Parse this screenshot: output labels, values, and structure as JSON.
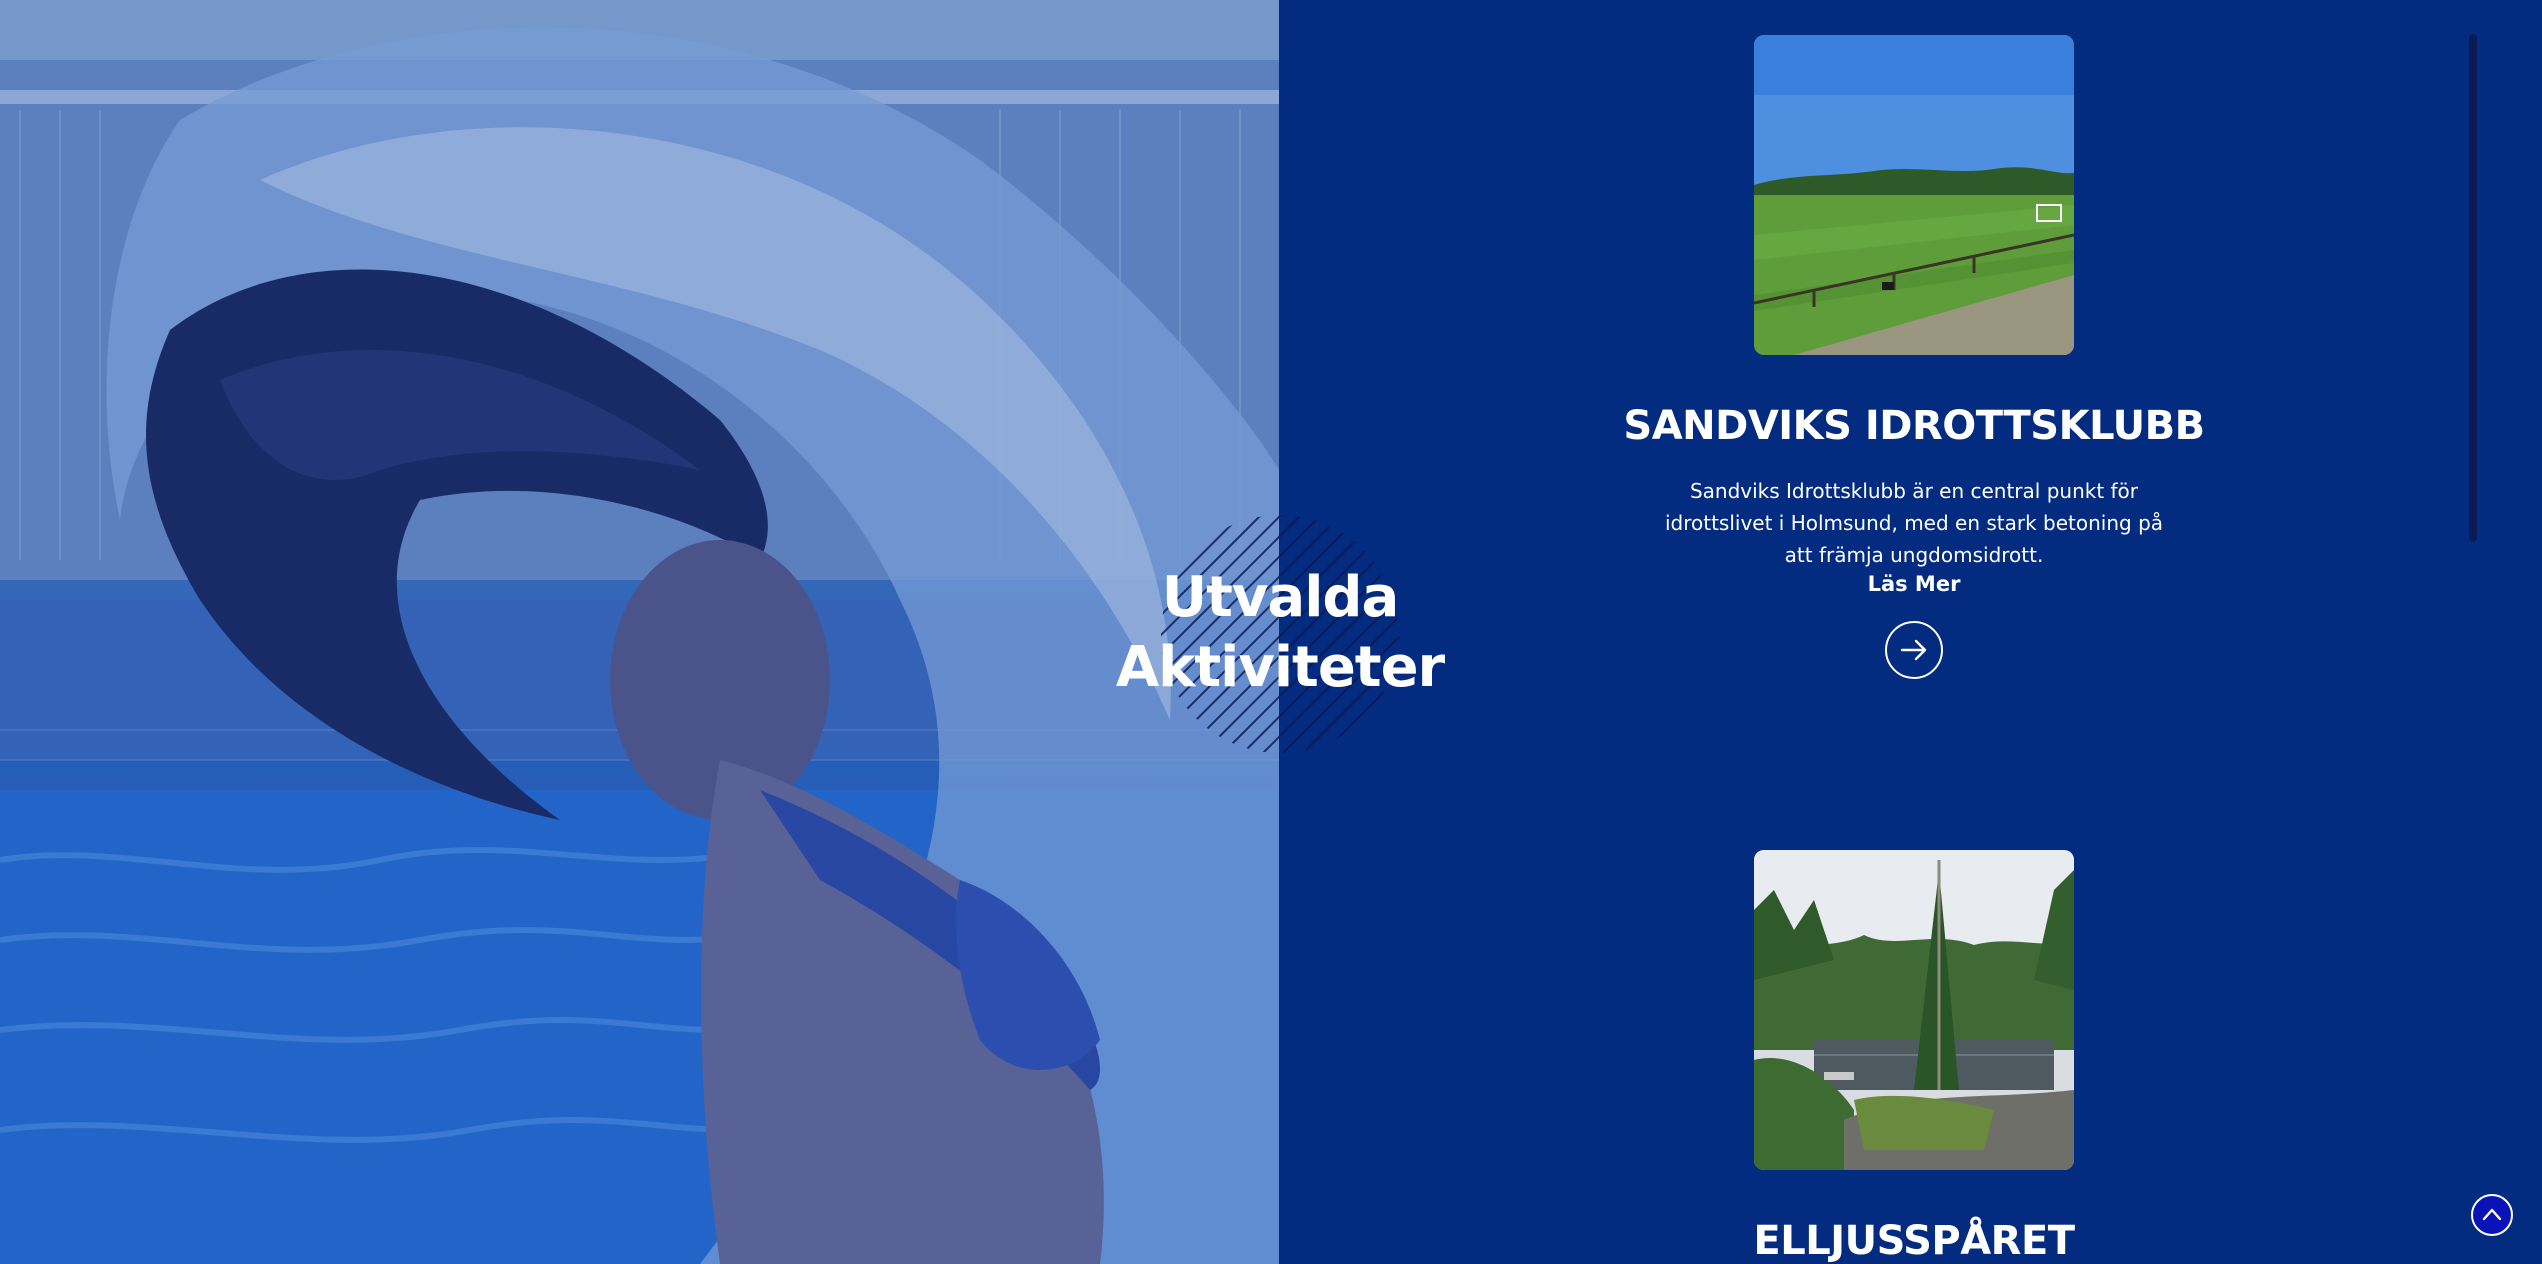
{
  "section": {
    "heading_line1": "Utvalda",
    "heading_line2": "Aktiviteter"
  },
  "hero_image": {
    "icon": "photo-swimmer-splash"
  },
  "activities": [
    {
      "title": "SANDVIKS IDROTTSKLUBB",
      "description": "Sandviks Idrottsklubb är en central punkt för idrottslivet i Holmsund, med en stark betoning på att främja ungdomsidrott.",
      "more_label": "Läs Mer",
      "image": "sports-field-photo",
      "arrow_icon": "arrow-right-icon"
    },
    {
      "title": "ELLJUSSPÅRET",
      "image": "forest-lake-photo"
    }
  ],
  "colors": {
    "panel_background": "#032c80",
    "text": "#ffffff",
    "back_to_top": "#0a13b8"
  }
}
